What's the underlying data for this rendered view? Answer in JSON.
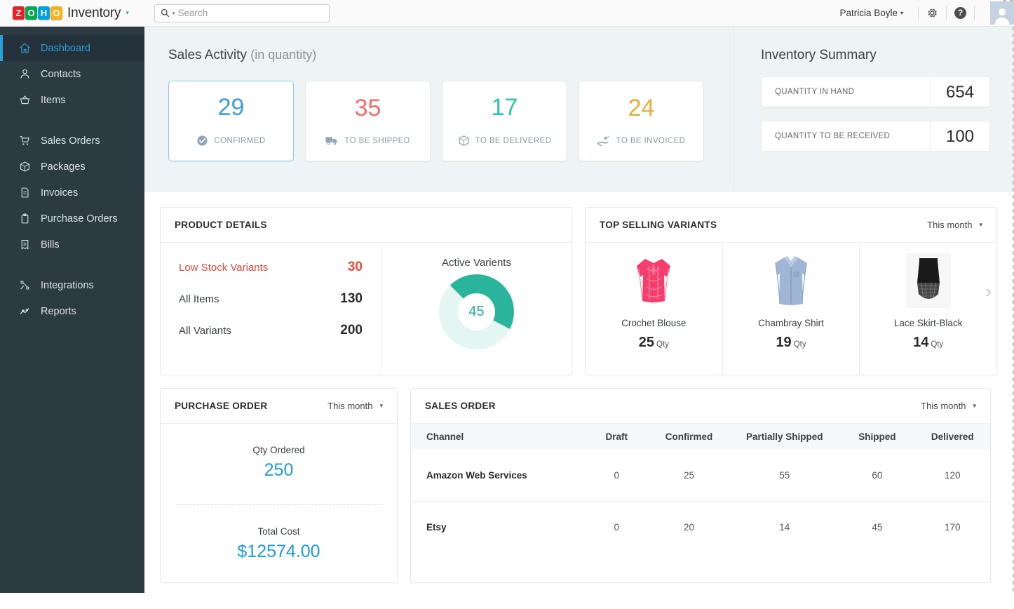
{
  "header": {
    "logo_letters": [
      "Z",
      "O",
      "H",
      "O"
    ],
    "app_name": "Inventory",
    "app_caret": "▾",
    "search": {
      "placeholder": "Search",
      "icon": "search-icon",
      "caret": "▾"
    },
    "user_name": "Patricia Boyle",
    "user_caret": "▾",
    "settings_icon": "gear-icon",
    "help_icon": "help-icon",
    "help_glyph": "?",
    "avatar": "user-avatar"
  },
  "sidebar": {
    "items": [
      {
        "label": "Dashboard",
        "icon": "home-icon",
        "active": true
      },
      {
        "label": "Contacts",
        "icon": "person-icon",
        "active": false
      },
      {
        "label": "Items",
        "icon": "basket-icon",
        "active": false
      },
      {
        "label": "Sales Orders",
        "icon": "cart-icon",
        "active": false
      },
      {
        "label": "Packages",
        "icon": "box-icon",
        "active": false
      },
      {
        "label": "Invoices",
        "icon": "document-icon",
        "active": false
      },
      {
        "label": "Purchase Orders",
        "icon": "clipboard-icon",
        "active": false
      },
      {
        "label": "Bills",
        "icon": "bill-icon",
        "active": false
      },
      {
        "label": "Integrations",
        "icon": "integrations-icon",
        "active": false
      },
      {
        "label": "Reports",
        "icon": "chart-line-icon",
        "active": false
      }
    ]
  },
  "sales_activity": {
    "title": "Sales Activity",
    "subtitle": "(in quantity)",
    "cards": [
      {
        "value": "29",
        "label": "CONFIRMED",
        "color": "#3f9ed8",
        "icon": "check-circle-icon",
        "selected": true
      },
      {
        "value": "35",
        "label": "TO BE SHIPPED",
        "color": "#ef6f6c",
        "icon": "truck-icon",
        "selected": false
      },
      {
        "value": "17",
        "label": "TO BE DELIVERED",
        "color": "#2ec4a4",
        "icon": "package-icon",
        "selected": false
      },
      {
        "value": "24",
        "label": "TO BE INVOICED",
        "color": "#e8ae3c",
        "icon": "hand-coin-icon",
        "selected": false
      }
    ]
  },
  "inventory_summary": {
    "title": "Inventory Summary",
    "rows": [
      {
        "label": "QUANTITY IN HAND",
        "value": "654"
      },
      {
        "label": "QUANTITY TO BE RECEIVED",
        "value": "100"
      }
    ]
  },
  "product_details": {
    "title": "PRODUCT DETAILS",
    "lines": [
      {
        "label": "Low Stock Variants",
        "value": "30",
        "highlight": true
      },
      {
        "label": "All Items",
        "value": "130",
        "highlight": false
      },
      {
        "label": "All Variants",
        "value": "200",
        "highlight": false
      }
    ],
    "chart_title": "Active Varients",
    "chart_center": "45"
  },
  "top_selling": {
    "title": "TOP SELLING VARIANTS",
    "period": "This month",
    "period_caret": "▾",
    "next_arrow": "chevron-right-icon",
    "items": [
      {
        "name": "Crochet Blouse",
        "qty": "25",
        "unit": "Qty",
        "image": "crochet-blouse-pink"
      },
      {
        "name": "Chambray Shirt",
        "qty": "19",
        "unit": "Qty",
        "image": "chambray-shirt-blue"
      },
      {
        "name": "Lace Skirt-Black",
        "qty": "14",
        "unit": "Qty",
        "image": "lace-skirt-black"
      }
    ]
  },
  "purchase_order": {
    "title": "PURCHASE ORDER",
    "period": "This month",
    "period_caret": "▾",
    "qty_label": "Qty Ordered",
    "qty_value": "250",
    "cost_label": "Total Cost",
    "cost_value": "$12574.00"
  },
  "sales_order": {
    "title": "SALES ORDER",
    "period": "This month",
    "period_caret": "▾",
    "columns": [
      "Channel",
      "Draft",
      "Confirmed",
      "Partially Shipped",
      "Shipped",
      "Delivered"
    ],
    "rows": [
      {
        "channel": "Amazon Web Services",
        "draft": "0",
        "confirmed": "25",
        "partially_shipped": "55",
        "shipped": "60",
        "delivered": "120"
      },
      {
        "channel": "Etsy",
        "draft": "0",
        "confirmed": "20",
        "partially_shipped": "14",
        "shipped": "45",
        "delivered": "170"
      }
    ]
  },
  "chart_data": {
    "type": "pie",
    "title": "Active Varients",
    "categories": [
      "Active Variants",
      "Inactive Variants"
    ],
    "values": [
      45,
      55
    ],
    "colors": [
      "#2bb49c",
      "#e4f6f2"
    ],
    "center_label": "45",
    "legend": "none"
  },
  "colors": {
    "accent_blue": "#2a9fd8",
    "sidebar_bg": "#2c3a42",
    "teal": "#2bb49c",
    "red": "#e74c3c"
  }
}
